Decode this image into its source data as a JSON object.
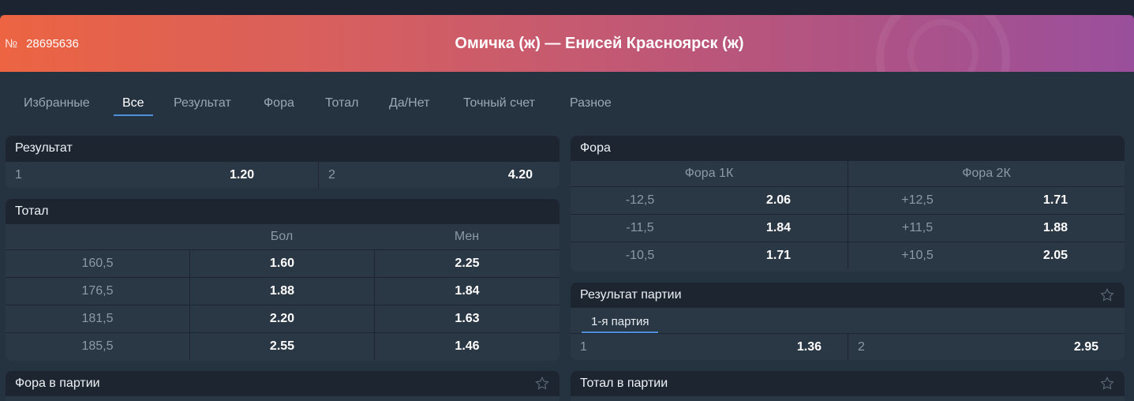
{
  "header": {
    "number_symbol": "№",
    "match_number": "28695636",
    "match_title": "Омичка (ж) — Енисей Красноярск (ж)"
  },
  "tabs": [
    {
      "label": "Избранные"
    },
    {
      "label": "Все"
    },
    {
      "label": "Результат"
    },
    {
      "label": "Фора"
    },
    {
      "label": "Тотал"
    },
    {
      "label": "Да/Нет"
    },
    {
      "label": "Точный счет"
    },
    {
      "label": "Разное"
    }
  ],
  "active_tab": "Все",
  "markets": {
    "result": {
      "title": "Результат",
      "outcomes": [
        {
          "label": "1",
          "odd": "1.20"
        },
        {
          "label": "2",
          "odd": "4.20"
        }
      ]
    },
    "total": {
      "title": "Тотал",
      "col_over": "Бол",
      "col_under": "Мен",
      "rows": [
        {
          "line": "160,5",
          "over": "1.60",
          "under": "2.25"
        },
        {
          "line": "176,5",
          "over": "1.88",
          "under": "1.84"
        },
        {
          "line": "181,5",
          "over": "2.20",
          "under": "1.63"
        },
        {
          "line": "185,5",
          "over": "2.55",
          "under": "1.46"
        }
      ]
    },
    "handicap": {
      "title": "Фора",
      "col_1": "Фора 1К",
      "col_2": "Фора 2К",
      "rows": [
        {
          "h1": "-12,5",
          "o1": "2.06",
          "h2": "+12,5",
          "o2": "1.71"
        },
        {
          "h1": "-11,5",
          "o1": "1.84",
          "h2": "+11,5",
          "o2": "1.88"
        },
        {
          "h1": "-10,5",
          "o1": "1.71",
          "h2": "+10,5",
          "o2": "2.05"
        }
      ]
    },
    "set_result": {
      "title": "Результат партии",
      "subtab": "1-я партия",
      "outcomes": [
        {
          "label": "1",
          "odd": "1.36"
        },
        {
          "label": "2",
          "odd": "2.95"
        }
      ]
    },
    "set_handicap": {
      "title": "Фора в партии"
    },
    "set_total": {
      "title": "Тотал в партии"
    }
  },
  "icons": {
    "favorite": "star-outline-icon"
  },
  "colors": {
    "accent": "#4f8fd9",
    "banner_start": "#ec6442",
    "banner_end": "#9a4f9c"
  }
}
